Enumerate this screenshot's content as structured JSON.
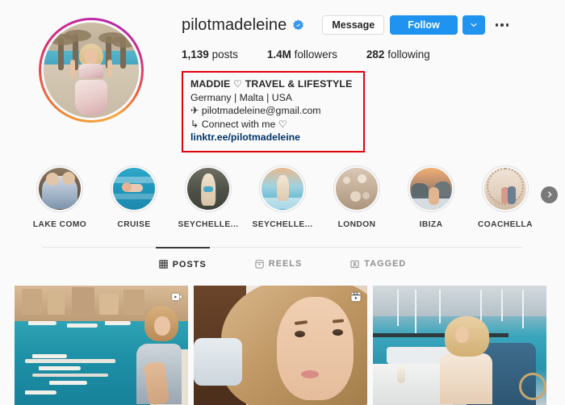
{
  "profile": {
    "username": "pilotmadeleine",
    "verified_icon": "verified-badge-icon",
    "avatar_alt": "profile-photo"
  },
  "actions": {
    "message_label": "Message",
    "follow_label": "Follow",
    "caret_icon": "chevron-down-icon",
    "more_icon": "more-options-icon"
  },
  "stats": [
    {
      "value": "1,139",
      "label": "posts"
    },
    {
      "value": "1.4M",
      "label": "followers"
    },
    {
      "value": "282",
      "label": "following"
    }
  ],
  "bio": {
    "name": "MADDIE ♡ TRAVEL & LIFESTYLE",
    "location": "Germany | Malta | USA",
    "email_icon": "✈",
    "email": "pilotmadeleine@gmail.com",
    "connect_icon": "↳",
    "connect": "Connect with me ♡",
    "link": "linktr.ee/pilotmadeleine",
    "highlight_border_color": "#e4000f",
    "link_color": "#003569"
  },
  "highlights": {
    "items": [
      {
        "label": "LAKE COMO"
      },
      {
        "label": "CRUISE"
      },
      {
        "label": "SEYCHELLE..."
      },
      {
        "label": "SEYCHELLE..."
      },
      {
        "label": "LONDON"
      },
      {
        "label": "IBIZA"
      },
      {
        "label": "COACHELLA"
      }
    ],
    "next_icon": "chevron-right-icon"
  },
  "tabs": [
    {
      "label": "POSTS",
      "icon": "grid-icon",
      "active": true
    },
    {
      "label": "REELS",
      "icon": "reels-icon",
      "active": false
    },
    {
      "label": "TAGGED",
      "icon": "tagged-icon",
      "active": false
    }
  ],
  "posts": [
    {
      "badge": "video-icon"
    },
    {
      "badge": "reels-icon"
    },
    {
      "badge": "none"
    }
  ],
  "colors": {
    "accent": "#1f93ef",
    "background": "#fafafa",
    "text": "#262626",
    "muted": "#8e8e8e"
  }
}
